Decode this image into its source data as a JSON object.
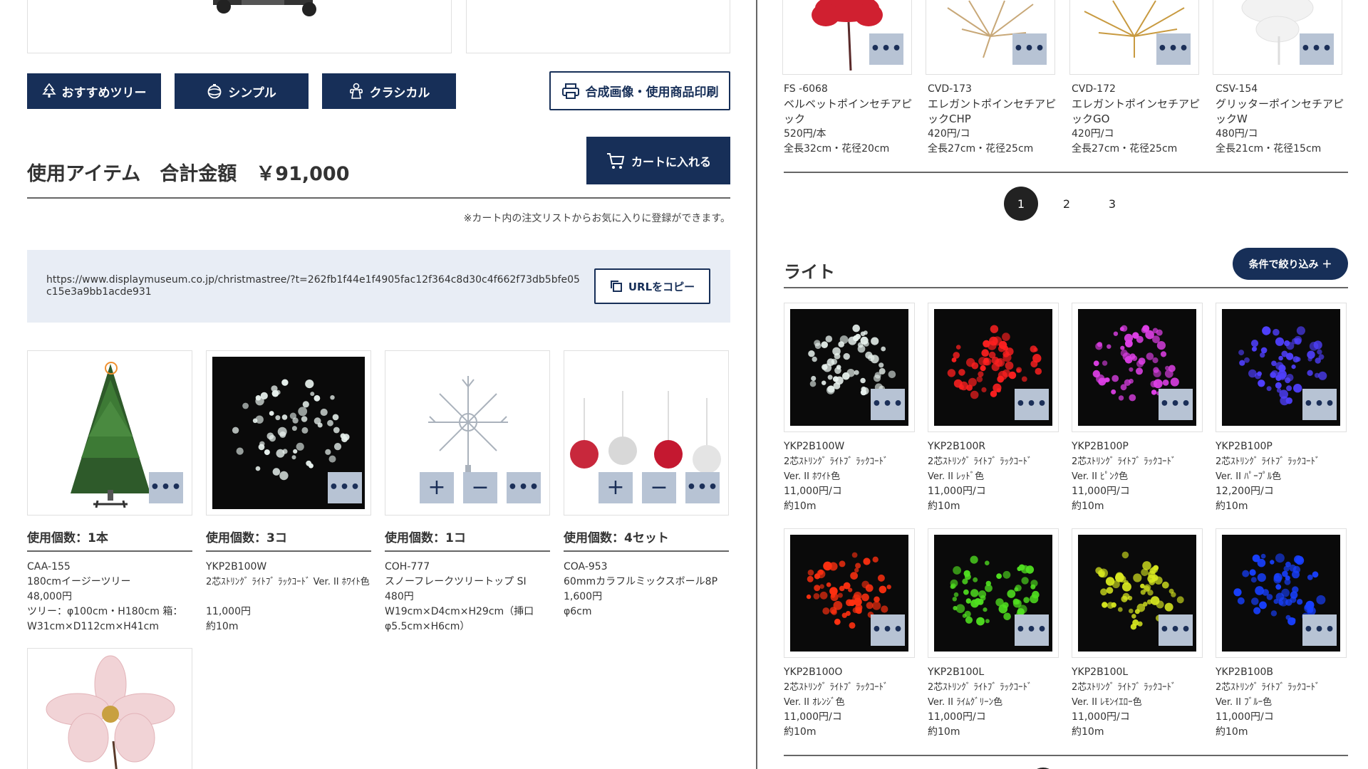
{
  "colors": {
    "navy": "#172f58",
    "dots_bg": "#b7c3d4",
    "url_box": "#e8edf5"
  },
  "tabs": [
    {
      "label": "おすすめツリー",
      "icon": "tree-icon"
    },
    {
      "label": "シンプル",
      "icon": "ornament-icon"
    },
    {
      "label": "クラシカル",
      "icon": "angel-icon"
    }
  ],
  "print_button": {
    "label": "合成画像・使用商品印刷",
    "icon": "printer-icon"
  },
  "cart_button": {
    "label": "カートに入れる",
    "icon": "cart-icon"
  },
  "summary": {
    "title": "使用アイテム　合計金額　￥91,000"
  },
  "note": "※カート内の注文リストからお気に入りに登録ができます。",
  "share": {
    "url": "https://www.displaymuseum.co.jp/christmastree/?t=262fb1f44e1f4905fac12f364c8d30c4f662f73db5bfe05c15e3a9bb1acde931",
    "copy_label": "URLをコピー"
  },
  "dots_label": "•••",
  "plus_label": "+",
  "minus_label": "−",
  "used_items": [
    {
      "count": "使用個数：1本",
      "code": "CAA-155",
      "name": "180cmイージーツリー",
      "price": "48,000円",
      "spec": "ツリー：φ100cm・H180cm 箱：W31cm×D112cm×H41cm"
    },
    {
      "count": "使用個数：3コ",
      "code": "YKP2B100W",
      "name": "2芯ｽﾄﾘﾝｸﾞ ﾗｲﾄﾌﾞ ﾗｯｸｺｰﾄﾞ Ver. II ﾎﾜｲﾄ色",
      "price": "11,000円",
      "spec": "約10m"
    },
    {
      "count": "使用個数：1コ",
      "code": "COH-777",
      "name": "スノーフレークツリートップ SI",
      "price": "480円",
      "spec": "W19cm×D4cm×H29cm（挿口φ5.5cm×H6cm）"
    },
    {
      "count": "使用個数：4セット",
      "code": "COA-953",
      "name": "60mmカラフルミックスボール8P",
      "price": "1,600円",
      "spec": "φ6cm"
    }
  ],
  "top_products": [
    {
      "code": "FS -6068",
      "name": "ベルベットポインセチアピック",
      "price": "520円/本",
      "spec": "全長32cm・花径20cm"
    },
    {
      "code": "CVD-173",
      "name": "エレガントポインセチアピックCHP",
      "price": "420円/コ",
      "spec": "全長27cm・花径25cm"
    },
    {
      "code": "CVD-172",
      "name": "エレガントポインセチアピックGO",
      "price": "420円/コ",
      "spec": "全長27cm・花径25cm"
    },
    {
      "code": "CSV-154",
      "name": "グリッターポインセチアピックW",
      "price": "480円/コ",
      "spec": "全長21cm・花径15cm"
    }
  ],
  "pagination": {
    "pages": [
      "1",
      "2",
      "3"
    ],
    "current": "1"
  },
  "lights_section": {
    "title": "ライト",
    "filter_label": "条件で絞り込み ＋"
  },
  "lights": [
    {
      "code": "YKP2B100W",
      "name": "2芯ｽﾄﾘﾝｸﾞ ﾗｲﾄﾌﾞ ﾗｯｸｺｰﾄﾞ\nVer. II ﾎﾜｲﾄ色",
      "price": "11,000円/コ",
      "spec": "約10m",
      "color": "#e8f2ee"
    },
    {
      "code": "YKP2B100R",
      "name": "2芯ｽﾄﾘﾝｸﾞ ﾗｲﾄﾌﾞ ﾗｯｸｺｰﾄﾞ\nVer. II ﾚｯﾄﾞ色",
      "price": "11,000円/コ",
      "spec": "約10m",
      "color": "#ff2020"
    },
    {
      "code": "YKP2B100P",
      "name": "2芯ｽﾄﾘﾝｸﾞ ﾗｲﾄﾌﾞ ﾗｯｸｺｰﾄﾞ\nVer. II ﾋﾟﾝｸ色",
      "price": "11,000円/コ",
      "spec": "約10m",
      "color": "#e040e8"
    },
    {
      "code": "YKP2B100P",
      "name": "2芯ｽﾄﾘﾝｸﾞ ﾗｲﾄﾌﾞ ﾗｯｸｺｰﾄﾞ\nVer. II ﾊﾟｰﾌﾟﾙ色",
      "price": "12,200円/コ",
      "spec": "約10m",
      "color": "#5040ff"
    },
    {
      "code": "YKP2B100O",
      "name": "2芯ｽﾄﾘﾝｸﾞ ﾗｲﾄﾌﾞ ﾗｯｸｺｰﾄﾞ\nVer. II ｵﾚﾝｼﾞ色",
      "price": "11,000円/コ",
      "spec": "約10m",
      "color": "#ff3010"
    },
    {
      "code": "YKP2B100L",
      "name": "2芯ｽﾄﾘﾝｸﾞ ﾗｲﾄﾌﾞ ﾗｯｸｺｰﾄﾞ\nVer. II ﾗｲﾑｸﾞﾘｰﾝ色",
      "price": "11,000円/コ",
      "spec": "約10m",
      "color": "#50e020"
    },
    {
      "code": "YKP2B100L",
      "name": "2芯ｽﾄﾘﾝｸﾞ ﾗｲﾄﾌﾞ ﾗｯｸｺｰﾄﾞ\nVer. II ﾚﾓﾝｲｴﾛｰ色",
      "price": "11,000円/コ",
      "spec": "約10m",
      "color": "#d8e820"
    },
    {
      "code": "YKP2B100B",
      "name": "2芯ｽﾄﾘﾝｸﾞ ﾗｲﾄﾌﾞ ﾗｯｸｺｰﾄﾞ\nVer. II ﾌﾞﾙｰ色",
      "price": "11,000円/コ",
      "spec": "約10m",
      "color": "#1840ff"
    }
  ]
}
